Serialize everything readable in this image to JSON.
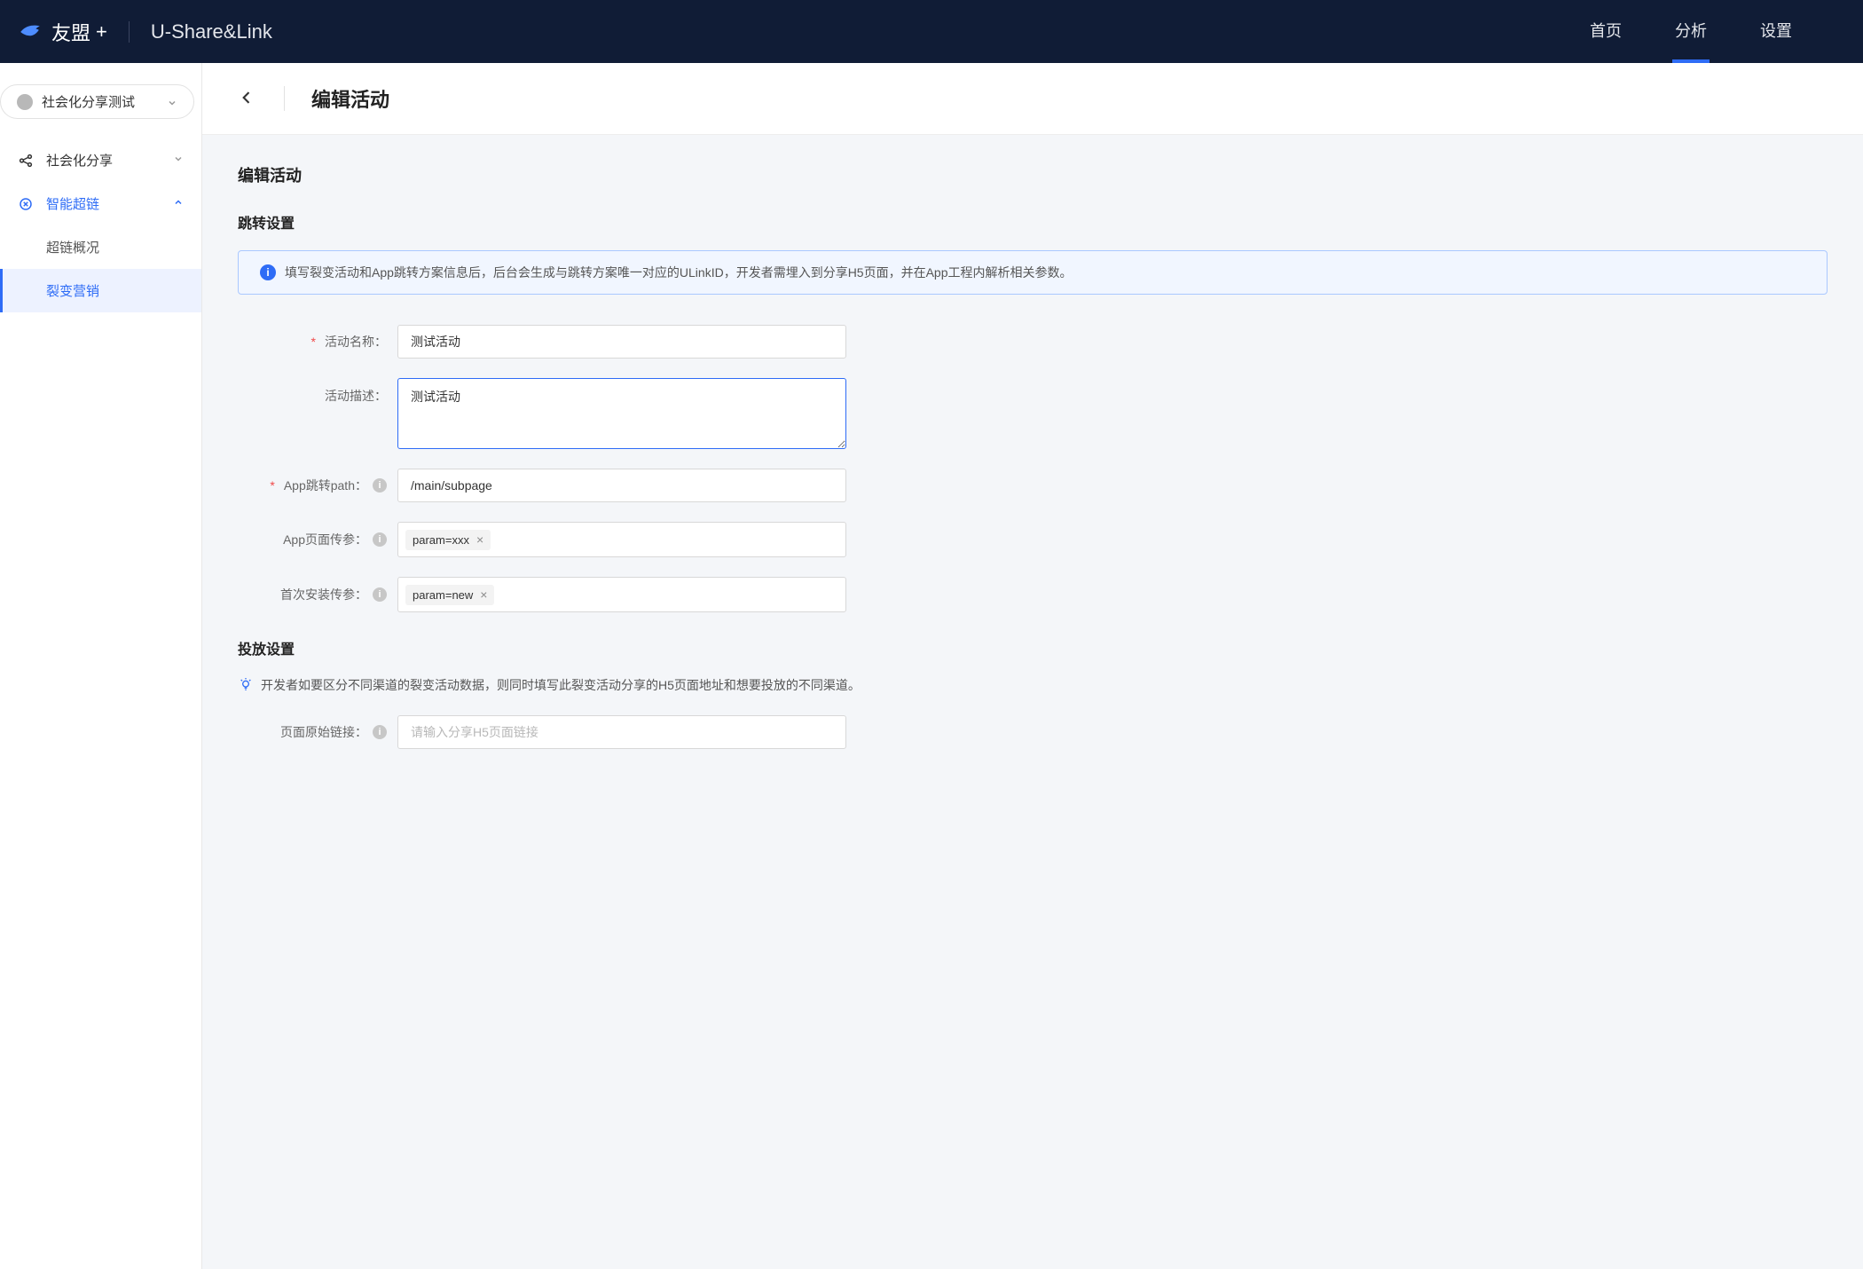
{
  "header": {
    "logo_text": "友盟",
    "logo_plus": "+",
    "product_name": "U-Share&Link",
    "tabs": [
      {
        "label": "首页"
      },
      {
        "label": "分析",
        "active": true
      },
      {
        "label": "设置"
      }
    ]
  },
  "sidebar": {
    "app_selector_label": "社会化分享测试",
    "groups": [
      {
        "label": "社会化分享",
        "icon": "share-icon",
        "expanded": false
      },
      {
        "label": "智能超链",
        "icon": "link-icon",
        "expanded": true,
        "active": true,
        "children": [
          {
            "label": "超链概况"
          },
          {
            "label": "裂变营销",
            "selected": true
          }
        ]
      }
    ]
  },
  "page": {
    "title": "编辑活动",
    "section_title": "编辑活动",
    "jump_section": "跳转设置",
    "banner": "填写裂变活动和App跳转方案信息后，后台会生成与跳转方案唯一对应的ULinkID，开发者需埋入到分享H5页面，并在App工程内解析相关参数。",
    "form": {
      "name_label": "活动名称：",
      "name_value": "测试活动",
      "desc_label": "活动描述：",
      "desc_value": "测试活动",
      "path_label": "App跳转path：",
      "path_value": "/main/subpage",
      "page_param_label": "App页面传参：",
      "page_param_tag": "param=xxx",
      "install_param_label": "首次安装传参：",
      "install_param_tag": "param=new"
    },
    "deploy_section": "投放设置",
    "deploy_tip": "开发者如要区分不同渠道的裂变活动数据，则同时填写此裂变活动分享的H5页面地址和想要投放的不同渠道。",
    "orig_link_label": "页面原始链接：",
    "orig_link_placeholder": "请输入分享H5页面链接"
  }
}
